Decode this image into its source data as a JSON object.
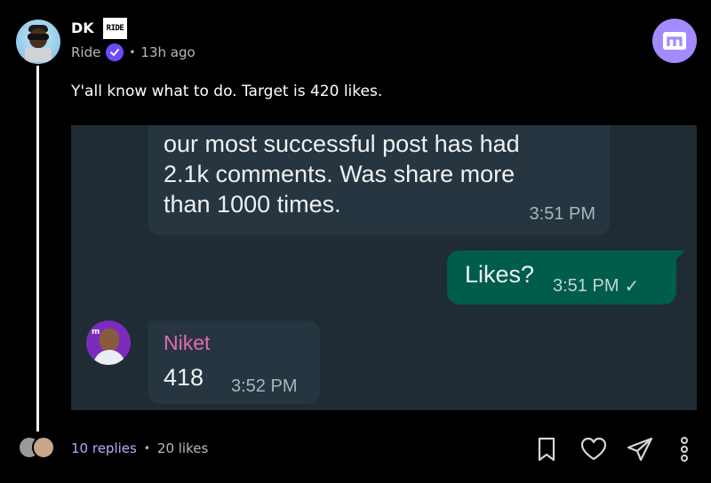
{
  "post": {
    "author": "DK",
    "brand_logo_text": "RIDE",
    "community": "Ride",
    "separator": "•",
    "timestamp": "13h ago",
    "text": "Y'all know what to do. Target is 420 likes."
  },
  "chat": {
    "top_message": {
      "line1": "our most successful post has had",
      "line2": "2.1k comments. Was share more",
      "line3": "than 1000 times.",
      "time": "3:51 PM"
    },
    "out_message": {
      "text": "Likes?",
      "time": "3:51 PM",
      "check": "✓"
    },
    "reply": {
      "avatar_mark": "m",
      "sender": "Niket",
      "text": "418",
      "time": "3:52 PM"
    }
  },
  "footer": {
    "replies": "10 replies",
    "separator": "•",
    "likes": "20 likes"
  },
  "icons": {
    "verified": "verified-badge-icon",
    "app": "m-app-icon",
    "bookmark": "bookmark-icon",
    "like": "heart-icon",
    "share": "send-icon",
    "more": "more-vertical-icon"
  },
  "colors": {
    "accent": "#6d4aff",
    "badge": "#a38bff",
    "replies": "#b9a7ff",
    "chat_bg": "#1f2c34",
    "bubble_in": "#263540",
    "bubble_out": "#005c4b",
    "sender": "#e26ab8"
  }
}
